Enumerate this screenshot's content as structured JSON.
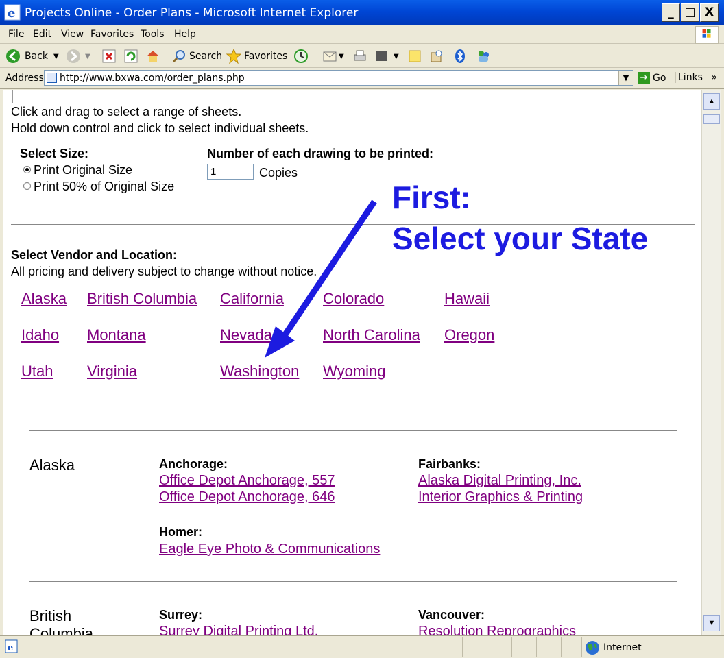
{
  "window": {
    "title": "Projects Online - Order Plans - Microsoft Internet Explorer",
    "min": "_",
    "max": "□",
    "close": "X"
  },
  "menu": [
    "File",
    "Edit",
    "View",
    "Favorites",
    "Tools",
    "Help"
  ],
  "toolbar": {
    "back": "Back",
    "search": "Search",
    "favorites": "Favorites"
  },
  "address": {
    "label": "Address",
    "url": "http://www.bxwa.com/order_plans.php",
    "go": "Go",
    "links": "Links"
  },
  "instructions": [
    "Click and drag to select a range of sheets.",
    "Hold down control and click to select individual sheets."
  ],
  "size": {
    "heading": "Select Size:",
    "options": [
      "Print Original Size",
      "Print 50% of Original Size"
    ],
    "selected": 0
  },
  "copies": {
    "heading": "Number of each drawing to be printed:",
    "value": "1",
    "suffix": "Copies"
  },
  "callout": {
    "line1": "First:",
    "line2": "Select your State",
    "color": "#1c1be0"
  },
  "vendor": {
    "heading": "Select Vendor and Location:",
    "note": "All pricing and delivery subject to change without notice."
  },
  "states": [
    "Alaska",
    "British Columbia",
    "California",
    "Colorado",
    "Hawaii",
    "Idaho",
    "Montana",
    "Nevada",
    "North Carolina",
    "Oregon",
    "Utah",
    "Virginia",
    "Washington",
    "Wyoming"
  ],
  "sections": [
    {
      "state": "Alaska",
      "cities": [
        {
          "name": "Anchorage:",
          "vendors": [
            "Office Depot Anchorage, 557",
            "Office Depot Anchorage, 646"
          ]
        },
        {
          "name": "Fairbanks:",
          "vendors": [
            "Alaska Digital Printing, Inc.",
            "Interior Graphics & Printing"
          ]
        },
        {
          "name": "Homer:",
          "vendors": [
            "Eagle Eye Photo & Communications"
          ]
        }
      ]
    },
    {
      "state": "British Columbia",
      "cities": [
        {
          "name": "Surrey:",
          "vendors": [
            "Surrey Digital Printing Ltd."
          ]
        },
        {
          "name": "Vancouver:",
          "vendors": [
            "Resolution Reprographics"
          ]
        }
      ]
    }
  ],
  "status": {
    "zone": "Internet"
  },
  "colors": {
    "link": "#800080",
    "arrow": "#1c1be0",
    "titlebar": "#0046d5"
  }
}
